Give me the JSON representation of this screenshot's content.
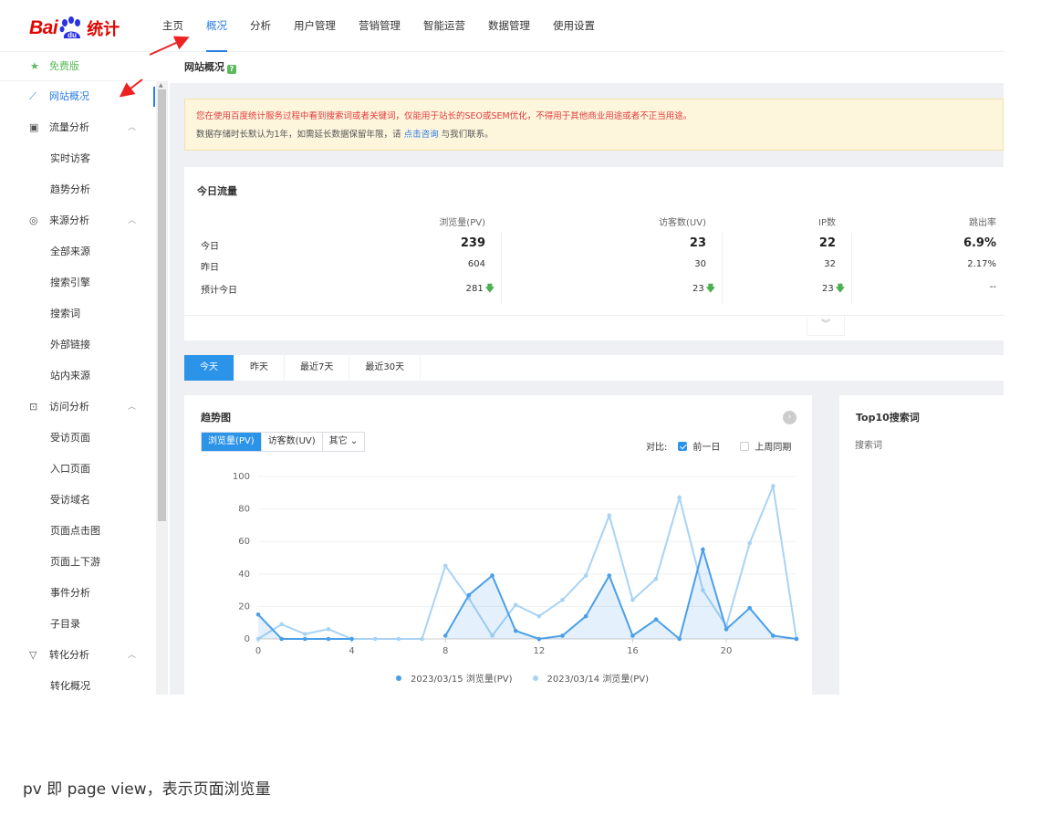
{
  "logo": {
    "text_bai": "Bai",
    "text_du": "du",
    "text_tj": "统计"
  },
  "topnav": {
    "items": [
      {
        "label": "主页"
      },
      {
        "label": "概况"
      },
      {
        "label": "分析"
      },
      {
        "label": "用户管理"
      },
      {
        "label": "营销管理"
      },
      {
        "label": "智能运营"
      },
      {
        "label": "数据管理"
      },
      {
        "label": "使用设置"
      }
    ],
    "active_index": 1
  },
  "sidebar": {
    "free_label": "免费版",
    "items": [
      {
        "label": "网站概况",
        "type": "group",
        "icon": "line-chart-icon",
        "active": true
      },
      {
        "label": "流量分析",
        "type": "group",
        "icon": "image-chart-icon"
      },
      {
        "label": "实时访客",
        "type": "sub"
      },
      {
        "label": "趋势分析",
        "type": "sub"
      },
      {
        "label": "来源分析",
        "type": "group",
        "icon": "signal-icon"
      },
      {
        "label": "全部来源",
        "type": "sub"
      },
      {
        "label": "搜索引擎",
        "type": "sub"
      },
      {
        "label": "搜索词",
        "type": "sub"
      },
      {
        "label": "外部链接",
        "type": "sub"
      },
      {
        "label": "站内来源",
        "type": "sub"
      },
      {
        "label": "访问分析",
        "type": "group",
        "icon": "download-box-icon"
      },
      {
        "label": "受访页面",
        "type": "sub"
      },
      {
        "label": "入口页面",
        "type": "sub"
      },
      {
        "label": "受访域名",
        "type": "sub"
      },
      {
        "label": "页面点击图",
        "type": "sub"
      },
      {
        "label": "页面上下游",
        "type": "sub"
      },
      {
        "label": "事件分析",
        "type": "sub"
      },
      {
        "label": "子目录",
        "type": "sub"
      },
      {
        "label": "转化分析",
        "type": "group",
        "icon": "funnel-icon"
      },
      {
        "label": "转化概况",
        "type": "sub"
      }
    ]
  },
  "page": {
    "title": "网站概况",
    "help": "?",
    "notice_line1": "您在使用百度统计服务过程中看到搜索词或者关键词，仅能用于站长的SEO或SEM优化，不得用于其他商业用途或者不正当用途。",
    "notice_line2_pre": "数据存储时长默认为1年，如需延长数据保留年限，请 ",
    "notice_link": "点击咨询",
    "notice_line2_post": " 与我们联系。"
  },
  "today": {
    "title": "今日流量",
    "columns": [
      "浏览量(PV)",
      "访客数(UV)",
      "IP数",
      "跳出率"
    ],
    "rows": [
      {
        "label": "今日",
        "values": [
          "239",
          "23",
          "22",
          "6.9%"
        ],
        "bold": true
      },
      {
        "label": "昨日",
        "values": [
          "604",
          "30",
          "32",
          "2.17%"
        ]
      },
      {
        "label": "预计今日",
        "values": [
          "281",
          "23",
          "23",
          "--"
        ],
        "down": [
          true,
          true,
          true,
          false
        ]
      }
    ],
    "down_arrow": "🡇",
    "expand_icon": "︾"
  },
  "range_tabs": [
    "今天",
    "昨天",
    "最近7天",
    "最近30天"
  ],
  "trend": {
    "title": "趋势图",
    "metric_buttons": [
      "浏览量(PV)",
      "访客数(UV)",
      "其它 ⌄"
    ],
    "compare_label": "对比:",
    "compare_prev_day": "前一日",
    "compare_last_week": "上周同期",
    "more_icon": "›"
  },
  "top10": {
    "title": "Top10搜索词",
    "sub": "搜索词"
  },
  "caption": "pv 即 page view，表示页面浏览量",
  "chart_data": {
    "type": "area",
    "title": "趋势图",
    "x": [
      0,
      1,
      2,
      3,
      4,
      5,
      6,
      7,
      8,
      9,
      10,
      11,
      12,
      13,
      14,
      15,
      16,
      17,
      18,
      19,
      20,
      21,
      22,
      23
    ],
    "xticks": [
      0,
      4,
      8,
      12,
      16,
      20
    ],
    "yticks": [
      0,
      20,
      40,
      60,
      80,
      100
    ],
    "ylim": [
      0,
      100
    ],
    "series": [
      {
        "name": "2023/03/15 浏览量(PV)",
        "color": "#4a9fe8",
        "values": [
          15,
          0,
          0,
          0,
          0,
          null,
          null,
          null,
          2,
          27,
          39,
          5,
          0,
          2,
          14,
          39,
          2,
          12,
          0,
          55,
          6,
          19,
          2,
          0
        ]
      },
      {
        "name": "2023/03/14 浏览量(PV)",
        "color": "#a9d3f5",
        "values": [
          0,
          9,
          3,
          6,
          0,
          0,
          0,
          0,
          45,
          25,
          2,
          21,
          14,
          24,
          39,
          76,
          24,
          37,
          87,
          30,
          8,
          59,
          94,
          0
        ]
      }
    ],
    "legend": "bottom",
    "grid": true
  }
}
